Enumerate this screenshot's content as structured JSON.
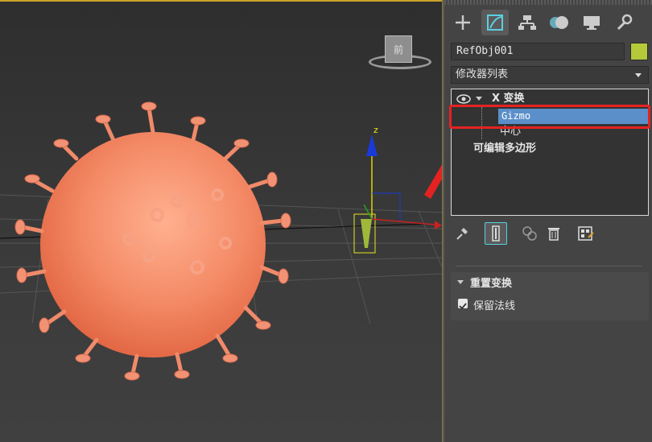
{
  "command_panel": {
    "tabs": [
      {
        "icon": "create-plus-icon"
      },
      {
        "icon": "modify-icon",
        "active": true
      },
      {
        "icon": "hierarchy-icon"
      },
      {
        "icon": "motion-icon"
      },
      {
        "icon": "display-icon"
      },
      {
        "icon": "utilities-wrench-icon"
      }
    ],
    "object_name": "RefObj001",
    "object_color": "#b5c93a",
    "modifier_list_label": "修改器列表",
    "stack": {
      "xform_label": "X  变换",
      "gizmo_label": "Gizmo",
      "center_label": "中心",
      "base_label": "可编辑多边形"
    },
    "rollout": {
      "title": "重置变换",
      "preserve_normals_label": "保留法线",
      "preserve_normals_checked": true
    }
  },
  "viewport": {
    "axis_z_label": "z",
    "viewcube_face_label": "前"
  },
  "colors": {
    "accent_selection": "#5b8fc9",
    "annotation_red": "#e52222",
    "virus_color": "#f08a6a"
  }
}
